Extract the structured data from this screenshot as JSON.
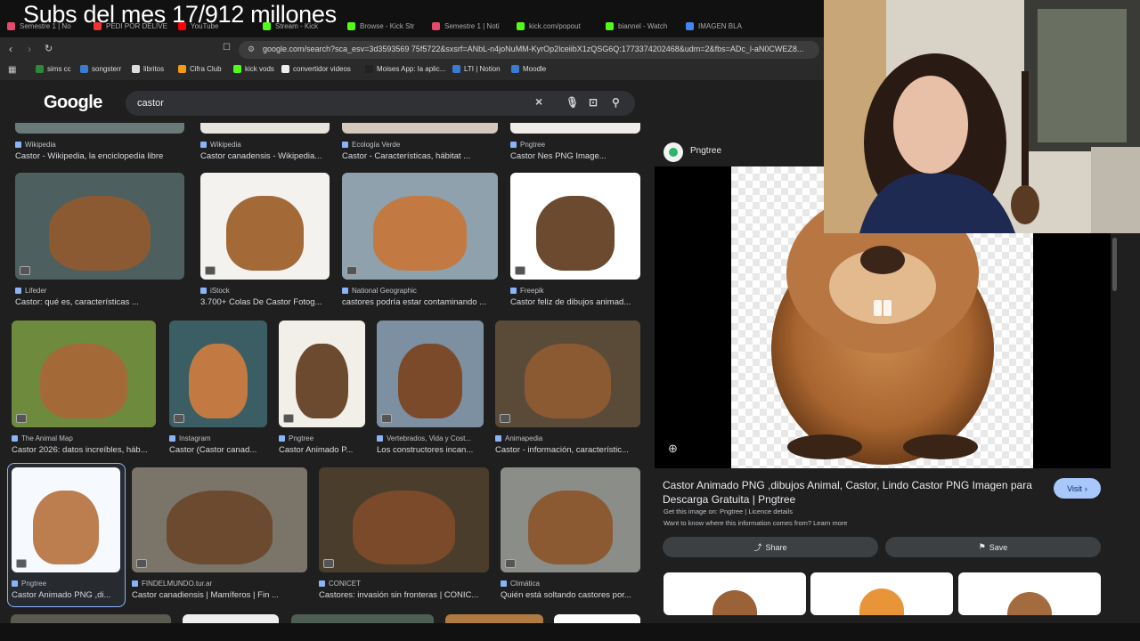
{
  "overlay_text": "Subs del mes 17/912 millones",
  "browser": {
    "tabs": [
      {
        "label": "Semestre 1 | No",
        "color": "#e34b6c"
      },
      {
        "label": "PEDI POR DELIVE",
        "color": "#e33"
      },
      {
        "label": "YouTube",
        "color": "#f00"
      },
      {
        "label": "Stream - Kick",
        "color": "#53fc18"
      },
      {
        "label": "Browse - Kick Str",
        "color": "#53fc18"
      },
      {
        "label": "Semestre 1 | Noti",
        "color": "#e34b6c"
      },
      {
        "label": "kick.com/popout",
        "color": "#53fc18"
      },
      {
        "label": "biannel - Watch",
        "color": "#53fc18"
      },
      {
        "label": "IMAGEN BLA",
        "color": "#4285f4"
      }
    ],
    "url": "google.com/search?sca_esv=3d3593569 75f5722&sxsrf=ANbL-n4joNuMM-KyrOp2lceiibX1zQSG6Q:1773374202468&udm=2&fbs=ADc_l-aN0CWEZ8...",
    "bookmarks": [
      {
        "label": "sims cc",
        "color": "#2a8a3a"
      },
      {
        "label": "songsterr",
        "color": "#3a7bd5"
      },
      {
        "label": "libritos",
        "color": "#ddd"
      },
      {
        "label": "Cifra Club",
        "color": "#f39c12"
      },
      {
        "label": "kick vods",
        "color": "#53fc18"
      },
      {
        "label": "convertidor videos",
        "color": "#eee"
      },
      {
        "label": "Moises App: la aplic...",
        "color": "#222"
      },
      {
        "label": "LTI | Notion",
        "color": "#3a7bd5"
      },
      {
        "label": "Moodle",
        "color": "#3a7bd5"
      }
    ]
  },
  "google": {
    "logo": "Google",
    "query": "castor"
  },
  "results": {
    "row0": [
      {
        "source": "Wikipedia",
        "title": "Castor - Wikipedia, la enciclopedia libre"
      },
      {
        "source": "Wikipedia",
        "title": "Castor canadensis - Wikipedia..."
      },
      {
        "source": "Ecología Verde",
        "title": "Castor - Características, hábitat ..."
      },
      {
        "source": "Pngtree",
        "title": "Castor Nes PNG Image..."
      }
    ],
    "row1": [
      {
        "source": "Lifeder",
        "title": "Castor: qué es, características ..."
      },
      {
        "source": "iStock",
        "title": "3.700+ Colas De Castor Fotog..."
      },
      {
        "source": "National Geographic",
        "title": "castores podría estar contaminando ..."
      },
      {
        "source": "Freepik",
        "title": "Castor feliz de dibujos animad..."
      }
    ],
    "row2": [
      {
        "source": "The Animal Map",
        "title": "Castor 2026: datos increíbles, háb..."
      },
      {
        "source": "Instagram",
        "title": "Castor (Castor canad..."
      },
      {
        "source": "Pngtree",
        "title": "Castor Animado P..."
      },
      {
        "source": "Vertebrados, Vida y Cost...",
        "title": "Los constructores incan..."
      },
      {
        "source": "Animapedia",
        "title": "Castor - información, característic..."
      }
    ],
    "row3": [
      {
        "source": "Pngtree",
        "title": "Castor Animado PNG ,di..."
      },
      {
        "source": "FINDELMUNDO.tur.ar",
        "title": "Castor canadiensis | Mamíferos | Fin ..."
      },
      {
        "source": "CONICET",
        "title": "Castores: invasión sin fronteras | CONIC..."
      },
      {
        "source": "Climática",
        "title": "Quién está soltando castores por..."
      }
    ]
  },
  "panel": {
    "source": "Pngtree",
    "title": "Castor Animado PNG ,dibujos Animal, Castor, Lindo Castor PNG Imagen para Descarga Gratuita | Pngtree",
    "get_this": "Get this image on: Pngtree | Licence details",
    "want_to_know": "Want to know where this information comes from? Learn more",
    "visit": "Visit",
    "share": "Share",
    "save": "Save"
  },
  "colors": {
    "bg": "#1f1f1f",
    "accent": "#a8c7fa"
  }
}
